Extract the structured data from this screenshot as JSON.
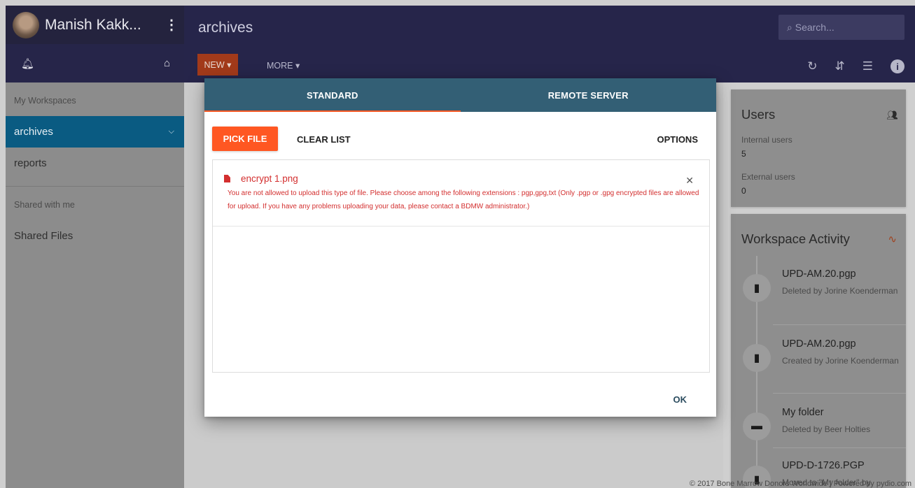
{
  "sidebar": {
    "username": "Manish Kakk...",
    "section_workspaces": "My Workspaces",
    "items": [
      {
        "label": "archives",
        "active": true
      },
      {
        "label": "reports"
      }
    ],
    "section_shared": "Shared with me",
    "shared_items": [
      {
        "label": "Shared Files"
      }
    ]
  },
  "header": {
    "title": "archives",
    "search_placeholder": "Search...",
    "new_label": "NEW ▾",
    "more_label": "MORE ▾"
  },
  "dialog": {
    "tabs": [
      {
        "label": "STANDARD",
        "active": true
      },
      {
        "label": "REMOTE SERVER"
      }
    ],
    "pick_file": "PICK FILE",
    "clear_list": "CLEAR LIST",
    "options": "OPTIONS",
    "file": {
      "name": "encrypt 1.png",
      "error": "You are not allowed to upload this type of file. Please choose among the following extensions : pgp,gpg,txt (Only .pgp or .gpg encrypted files are allowed for upload. If you have any problems uploading your data, please contact a BDMW administrator.)"
    },
    "ok": "OK"
  },
  "users_card": {
    "title": "Users",
    "internal_label": "Internal users",
    "internal_value": "5",
    "external_label": "External users",
    "external_value": "0"
  },
  "activity": {
    "title": "Workspace Activity",
    "items": [
      {
        "name": "UPD-AM.20.pgp",
        "desc": "Deleted by Jorine Koenderman",
        "icon": "file-icon"
      },
      {
        "name": "UPD-AM.20.pgp",
        "desc": "Created by Jorine Koenderman",
        "icon": "file-icon"
      },
      {
        "name": "My folder",
        "desc": "Deleted by Beer Holties",
        "icon": "folder-icon"
      },
      {
        "name": "UPD-D-1726.PGP",
        "desc": "Moved to \"My folder\" by",
        "icon": "file-icon"
      }
    ]
  },
  "footer": "© 2017 Bone Marrow Donors Worldwide | Powered by pydio.com",
  "colors": {
    "accent": "#ff5722",
    "dialog_tabs": "#335f75",
    "header": "#26254a",
    "active_item": "#0a5b82",
    "error": "#d32f2f"
  }
}
